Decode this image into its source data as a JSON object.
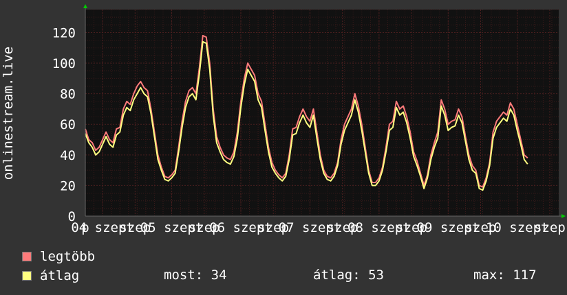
{
  "colors": {
    "background": "#333333",
    "plot_background": "#111111",
    "grid": "#4a1f1f",
    "axis_text": "#ffffff",
    "series_max": "#ff7b7b",
    "series_avg": "#ffff80",
    "axis_arrow": "#00cc00"
  },
  "chart_data": {
    "type": "line",
    "title": "",
    "ylabel": "onlinestream.live",
    "xlabel": "",
    "ylim": [
      0,
      135
    ],
    "yticks": [
      0,
      20,
      40,
      60,
      80,
      100,
      120
    ],
    "xticks": [
      {
        "label": "p",
        "x": 0.0
      },
      {
        "label": "04 szept",
        "x": 0.25
      },
      {
        "label": "szep",
        "x": 0.72
      },
      {
        "label": "05 szept",
        "x": 1.25
      },
      {
        "label": "szep",
        "x": 1.72
      },
      {
        "label": "06 szept",
        "x": 2.25
      },
      {
        "label": "szep",
        "x": 2.72
      },
      {
        "label": "07 szept",
        "x": 3.25
      },
      {
        "label": "szep",
        "x": 3.72
      },
      {
        "label": "08 szept",
        "x": 4.25
      },
      {
        "label": "szep",
        "x": 4.72
      },
      {
        "label": "09 szept",
        "x": 5.25
      },
      {
        "label": "szep",
        "x": 5.72
      },
      {
        "label": "10 szept",
        "x": 6.25
      },
      {
        "label": "szep",
        "x": 6.72
      }
    ],
    "xlim": [
      0,
      6.85
    ],
    "grid": true,
    "x": [
      0.0,
      0.05,
      0.1,
      0.15,
      0.2,
      0.25,
      0.3,
      0.35,
      0.4,
      0.45,
      0.5,
      0.55,
      0.6,
      0.65,
      0.7,
      0.75,
      0.8,
      0.85,
      0.9,
      0.95,
      1.0,
      1.05,
      1.1,
      1.15,
      1.2,
      1.25,
      1.3,
      1.35,
      1.4,
      1.45,
      1.5,
      1.55,
      1.6,
      1.65,
      1.7,
      1.75,
      1.8,
      1.85,
      1.9,
      1.95,
      2.0,
      2.05,
      2.1,
      2.15,
      2.2,
      2.25,
      2.3,
      2.35,
      2.4,
      2.45,
      2.5,
      2.55,
      2.6,
      2.65,
      2.7,
      2.75,
      2.8,
      2.85,
      2.9,
      2.95,
      3.0,
      3.05,
      3.1,
      3.15,
      3.2,
      3.25,
      3.3,
      3.35,
      3.4,
      3.45,
      3.5,
      3.55,
      3.6,
      3.65,
      3.7,
      3.75,
      3.8,
      3.85,
      3.9,
      3.95,
      4.0,
      4.05,
      4.1,
      4.15,
      4.2,
      4.25,
      4.3,
      4.35,
      4.4,
      4.45,
      4.5,
      4.55,
      4.6,
      4.65,
      4.7,
      4.75,
      4.8,
      4.85,
      4.9,
      4.95,
      5.0,
      5.05,
      5.1,
      5.15,
      5.2,
      5.25,
      5.3,
      5.35,
      5.4,
      5.45,
      5.5,
      5.55,
      5.6,
      5.65,
      5.7,
      5.75,
      5.8,
      5.85,
      5.9,
      5.95,
      6.0,
      6.05,
      6.1,
      6.15,
      6.2,
      6.25,
      6.3,
      6.35,
      6.4,
      6.45,
      6.5,
      6.55,
      6.6,
      6.65,
      6.7,
      6.75,
      6.8
    ],
    "series": [
      {
        "name": "legtöbb",
        "values": [
          57,
          50,
          48,
          43,
          45,
          50,
          55,
          50,
          48,
          57,
          58,
          70,
          75,
          73,
          80,
          85,
          88,
          84,
          82,
          70,
          55,
          40,
          32,
          26,
          25,
          27,
          30,
          45,
          62,
          75,
          82,
          84,
          80,
          97,
          118,
          117,
          100,
          70,
          52,
          45,
          40,
          38,
          37,
          42,
          55,
          75,
          90,
          100,
          96,
          92,
          80,
          75,
          60,
          45,
          35,
          30,
          27,
          25,
          28,
          40,
          57,
          58,
          65,
          70,
          65,
          62,
          70,
          55,
          40,
          30,
          26,
          25,
          28,
          35,
          50,
          60,
          65,
          70,
          80,
          72,
          60,
          45,
          30,
          22,
          22,
          25,
          32,
          45,
          60,
          62,
          75,
          70,
          72,
          65,
          55,
          42,
          36,
          28,
          20,
          27,
          40,
          48,
          55,
          76,
          70,
          60,
          62,
          63,
          70,
          65,
          52,
          40,
          33,
          30,
          20,
          19,
          25,
          35,
          55,
          62,
          65,
          68,
          66,
          74,
          70,
          60,
          50,
          40,
          38
        ]
      },
      {
        "name": "átlag",
        "values": [
          54,
          48,
          45,
          40,
          42,
          47,
          52,
          47,
          45,
          53,
          55,
          66,
          71,
          69,
          76,
          80,
          84,
          80,
          78,
          67,
          52,
          37,
          30,
          24,
          23,
          25,
          28,
          42,
          58,
          71,
          78,
          80,
          76,
          93,
          114,
          113,
          96,
          66,
          48,
          42,
          37,
          35,
          34,
          39,
          51,
          71,
          86,
          96,
          92,
          88,
          76,
          71,
          56,
          42,
          32,
          28,
          25,
          23,
          26,
          37,
          53,
          54,
          61,
          66,
          61,
          58,
          66,
          51,
          37,
          28,
          24,
          23,
          26,
          33,
          47,
          56,
          61,
          66,
          76,
          68,
          56,
          42,
          28,
          20,
          20,
          23,
          30,
          42,
          56,
          58,
          71,
          66,
          68,
          61,
          51,
          39,
          33,
          26,
          18,
          25,
          37,
          45,
          51,
          72,
          66,
          56,
          58,
          59,
          66,
          61,
          49,
          37,
          30,
          28,
          18,
          17,
          23,
          33,
          51,
          58,
          61,
          64,
          62,
          70,
          66,
          56,
          47,
          37,
          34
        ]
      }
    ]
  },
  "legend": {
    "items": [
      {
        "label": "legtöbb"
      },
      {
        "label": "átlag"
      }
    ],
    "stats": {
      "now": "most: 34",
      "avg": "átlag: 53",
      "max": "max: 117"
    }
  }
}
